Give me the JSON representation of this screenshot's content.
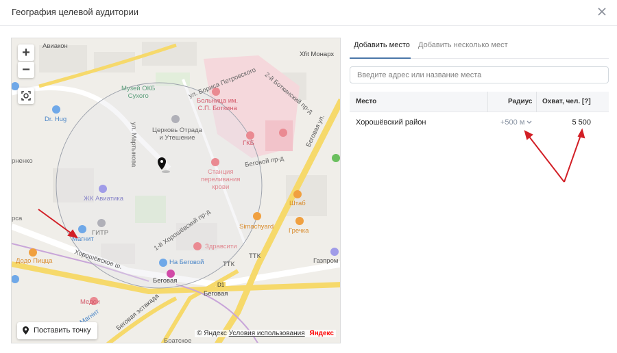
{
  "header": {
    "title": "География целевой аудитории"
  },
  "map": {
    "zoom_in": "+",
    "zoom_out": "−",
    "place_button": "Поставить точку",
    "copyright": "© Яндекс",
    "terms": "Условия использования",
    "brand": "Яндекс",
    "labels": {
      "aviakon": "Авиакон",
      "xfit": "Xfit Монарх",
      "boris": "ул. Бориса Петровского",
      "botkin_pr": "2-й Боткинский пр-д",
      "museum": "Музей ОКБ\nСухого",
      "hospital": "Больница им.\nС.П. Боткина",
      "drhug": "Dr. Hug",
      "church": "Церковь Отрада\nи Утешение",
      "gkb": "ГКБ",
      "begovoy_pr": "Беговой пр-д",
      "begovaya_ul": "Беговая ул.",
      "martynov": "ул. Мартынова",
      "station_blood": "Станция\nпереливания\nкрови",
      "zhk": "ЖК Авиатика",
      "shtab": "Штаб",
      "simachyard": "Simachyard",
      "gitr": "ГИТР",
      "grechka": "Гречка",
      "magnit": "Магнит",
      "khor1": "1-й Хорошёвский пр-д",
      "zdravsity": "Здравсити",
      "khor_shosse": "Хорошёвское ш.",
      "dodo": "Додо Пицца",
      "na_begovoy": "На Беговой",
      "ttk1": "ТТК",
      "ttk2": "ТТК",
      "gazprom": "Газпром",
      "begovaya_m": "Беговая",
      "d1": "D1",
      "begovaya_st": "Беговая",
      "medsi": "Медси",
      "magnit2": "Магнит",
      "begovaya_est": "Беговая эстакада",
      "bratskoe": "Братское",
      "renko": "рненко",
      "rsa": "рса"
    }
  },
  "tabs": [
    {
      "label": "Добавить место",
      "active": true
    },
    {
      "label": "Добавить несколько мест",
      "active": false
    }
  ],
  "search": {
    "placeholder": "Введите адрес или название места",
    "value": ""
  },
  "table": {
    "headers": {
      "place": "Место",
      "radius": "Радиус",
      "reach": "Охват, чел. [?]"
    },
    "rows": [
      {
        "place": "Хорошёвский район",
        "radius": "+500 м",
        "reach": "5 500"
      }
    ]
  },
  "colors": {
    "accent": "#4a76a8",
    "arrow": "#d21f26"
  }
}
